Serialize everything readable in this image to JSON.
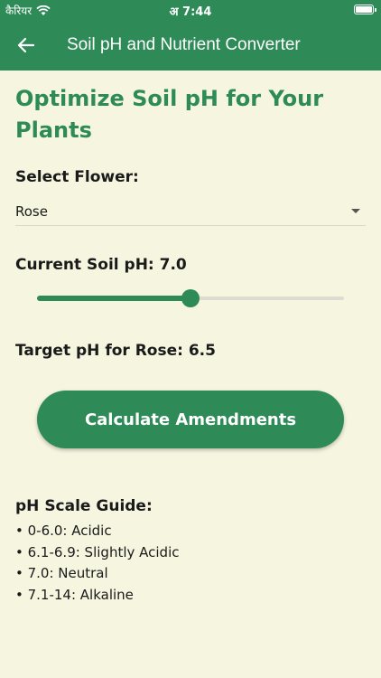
{
  "status_bar": {
    "carrier": "कैरियर",
    "time": "अ 7:44"
  },
  "app_bar": {
    "title": "Soil pH and Nutrient Converter",
    "back_icon": "arrow-left-icon"
  },
  "main": {
    "heading": "Optimize Soil pH for Your Plants",
    "select_label": "Select Flower:",
    "selected_flower": "Rose",
    "ph_label": "Current Soil pH: 7.0",
    "slider": {
      "value": 7.0,
      "min": 0,
      "max": 14
    },
    "target_label": "Target pH for Rose: 6.5",
    "calculate_button": "Calculate Amendments",
    "guide_title": "pH Scale Guide:",
    "guide_items": [
      "• 0-6.0: Acidic",
      "• 6.1-6.9: Slightly Acidic",
      "• 7.0: Neutral",
      "• 7.1-14: Alkaline"
    ]
  },
  "colors": {
    "primary": "#2e8b57",
    "background": "#f5f5e0"
  }
}
